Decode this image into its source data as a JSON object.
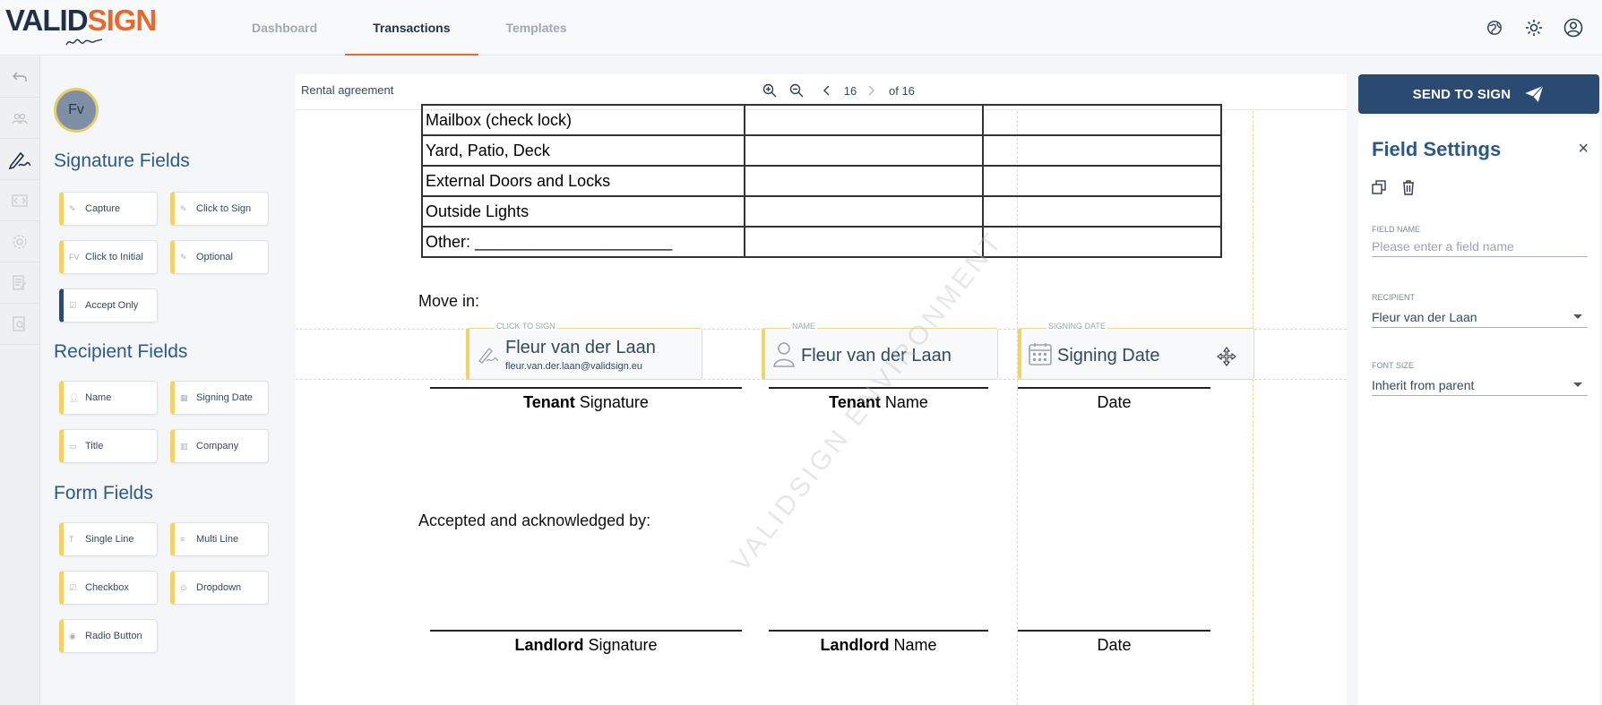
{
  "app": {
    "logo_valid": "VALID",
    "logo_sign": "SIGN"
  },
  "nav": {
    "tabs": [
      {
        "label": "Dashboard",
        "active": false
      },
      {
        "label": "Transactions",
        "active": true
      },
      {
        "label": "Templates",
        "active": false
      }
    ]
  },
  "top_icons": [
    "globe-icon",
    "sun-icon",
    "user-icon"
  ],
  "rail_icons": [
    "back-arrow-icon",
    "users-icon",
    "signature-icon",
    "code-icon",
    "settings-icon",
    "document-edit-icon",
    "document-search-icon"
  ],
  "palette": {
    "avatar_initials": "Fv",
    "signature_title": "Signature Fields",
    "signature_fields": [
      "Capture",
      "Click to Sign",
      "Click to Initial",
      "Optional",
      "Accept Only"
    ],
    "initial_icon_text": "FV",
    "recipient_title": "Recipient Fields",
    "recipient_fields": [
      "Name",
      "Signing Date",
      "Title",
      "Company"
    ],
    "form_title": "Form Fields",
    "form_fields": [
      "Single Line",
      "Multi Line",
      "Checkbox",
      "Dropdown",
      "Radio Button"
    ]
  },
  "document": {
    "title": "Rental agreement",
    "page": "16",
    "of_pages": "of 16",
    "table_rows": [
      "Mailbox (check lock)",
      "Yard, Patio, Deck",
      "External Doors and Locks",
      "Outside Lights",
      "Other: ______________________"
    ],
    "move_in": "Move in:",
    "accepted": "Accepted and acknowledged by:",
    "tenant_bold": "Tenant",
    "landlord_bold": "Landlord",
    "signature_word": " Signature",
    "name_word": " Name",
    "date_word": "Date",
    "watermark": "VALIDSIGN ENVIRONMENT"
  },
  "placed_fields": {
    "click_to_sign": {
      "tag": "CLICK TO SIGN",
      "name": "Fleur van der Laan",
      "email": "fleur.van.der.laan@validsign.eu"
    },
    "name": {
      "tag": "NAME",
      "name": "Fleur van der Laan"
    },
    "date": {
      "tag": "SIGNING DATE",
      "name": "Signing Date"
    }
  },
  "send_button": "SEND TO SIGN",
  "settings": {
    "title": "Field Settings",
    "field_name_label": "FIELD NAME",
    "field_name_placeholder": "Please enter a field name",
    "field_name_value": "",
    "recipient_label": "RECIPIENT",
    "recipient_value": "Fleur van der Laan",
    "font_size_label": "FONT SIZE",
    "font_size_value": "Inherit from parent"
  },
  "colors": {
    "brand_dark": "#1e3148",
    "brand_orange": "#e8692c",
    "field_accent": "#f2d36a",
    "primary_button": "#2b4a72",
    "heading_blue": "#2c5a85"
  }
}
